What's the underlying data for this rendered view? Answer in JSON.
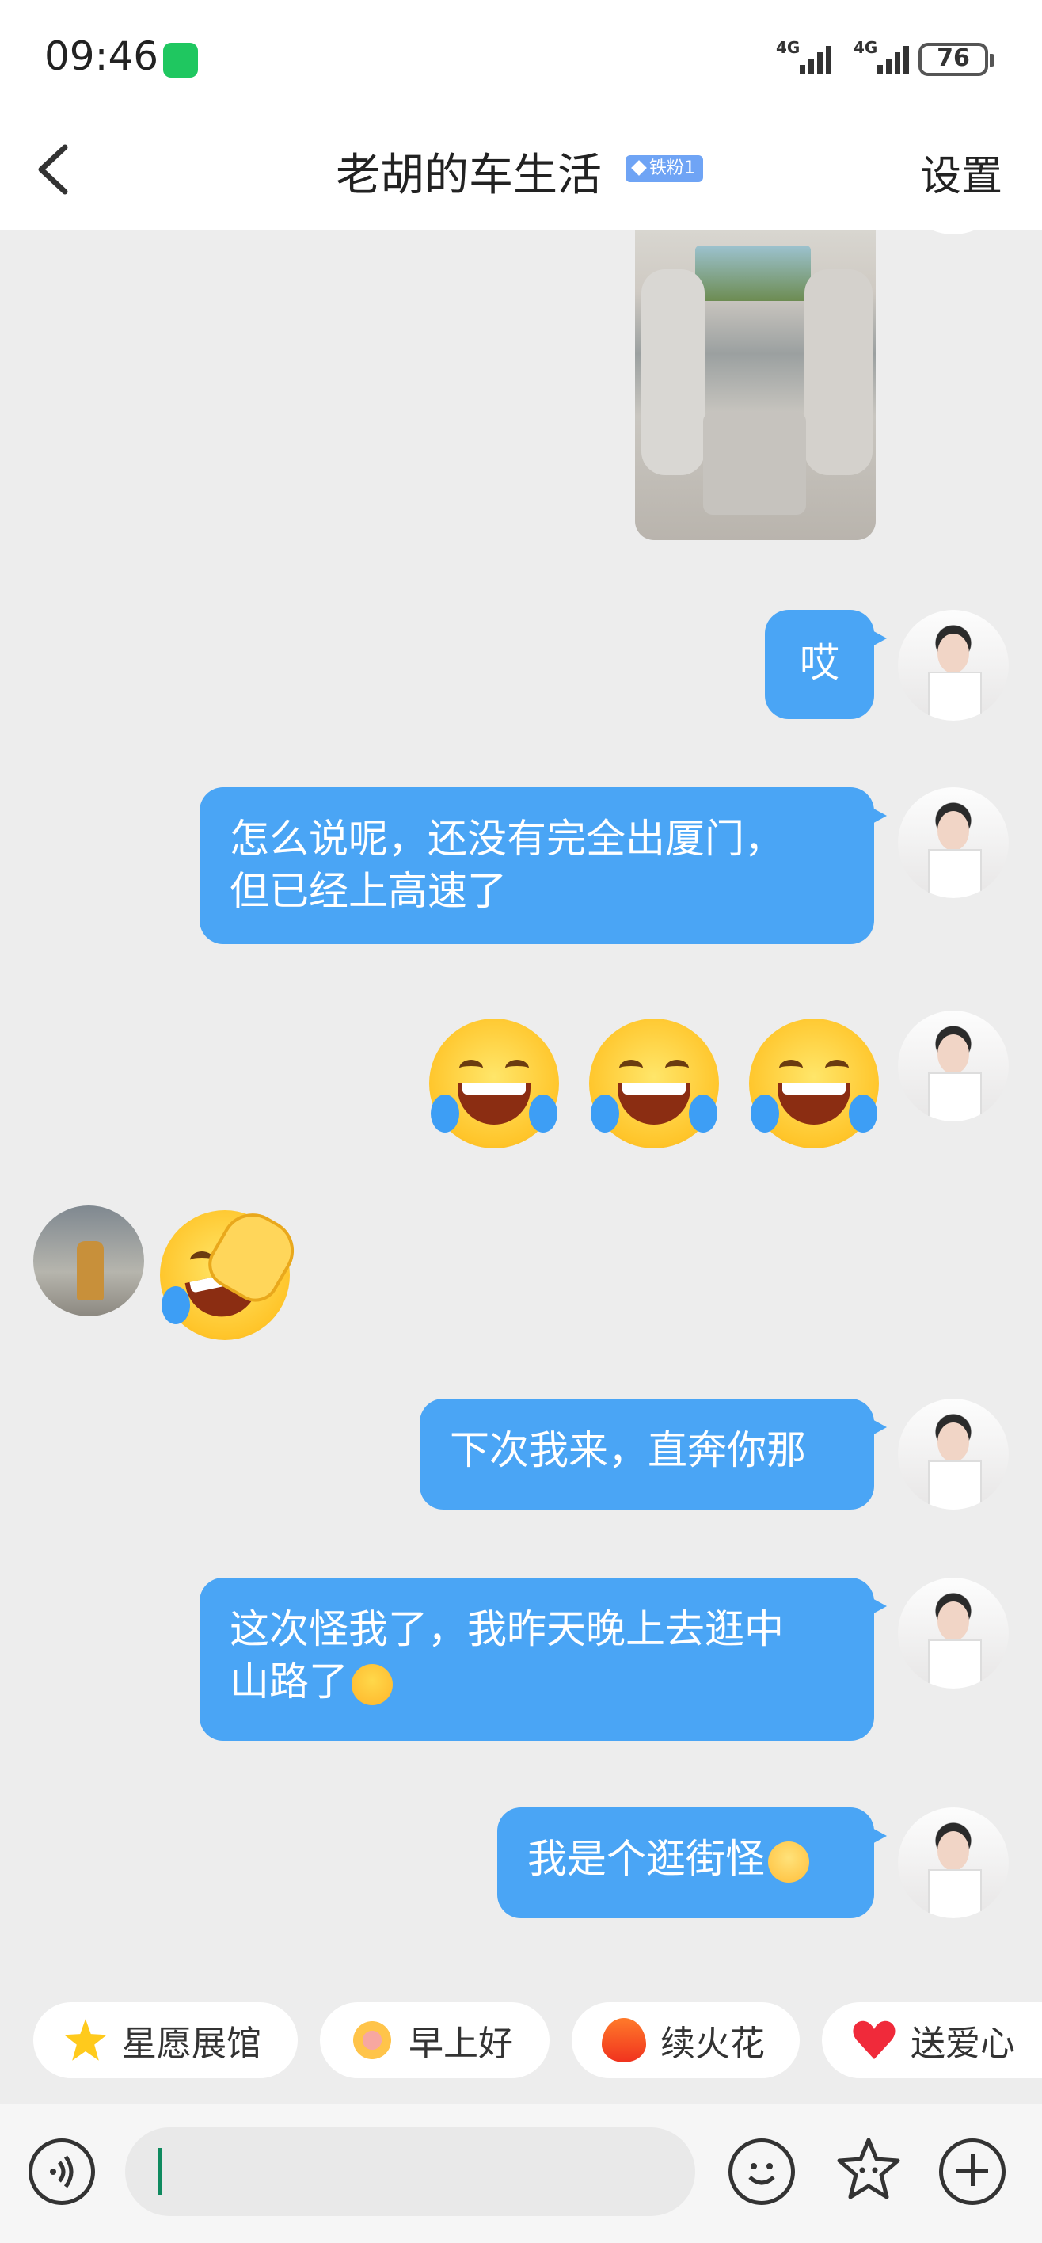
{
  "status_bar": {
    "time": "09:46",
    "network_1": "4G",
    "network_2": "4G",
    "battery": "76",
    "app_icon": "wechat-icon"
  },
  "header": {
    "title": "老胡的车生活",
    "badge": "铁粉1",
    "settings_label": "设置",
    "back_icon": "chevron-left-icon"
  },
  "messages": [
    {
      "sender": "me",
      "type": "image"
    },
    {
      "sender": "me",
      "type": "text",
      "lines": [
        "哎"
      ]
    },
    {
      "sender": "me",
      "type": "text",
      "lines": [
        "怎么说呢，还没有完全出厦门，",
        "但已经上高速了"
      ]
    },
    {
      "sender": "me",
      "type": "emoji",
      "emoji": [
        "laughing-crying-emoji",
        "laughing-crying-emoji",
        "laughing-crying-emoji"
      ]
    },
    {
      "sender": "other",
      "type": "emoji",
      "emoji": [
        "facepalm-laughing-emoji"
      ]
    },
    {
      "sender": "me",
      "type": "text",
      "lines": [
        "下次我来，直奔你那"
      ]
    },
    {
      "sender": "me",
      "type": "text",
      "lines": [
        "这次怪我了，我昨天晚上去逛中",
        "山路了"
      ],
      "trailing_emoji": "crying-emoji"
    },
    {
      "sender": "me",
      "type": "text",
      "lines": [
        "我是个逛街怪"
      ],
      "trailing_emoji": "teary-smile-emoji"
    }
  ],
  "quick_actions": [
    {
      "label": "星愿展馆",
      "icon": "star-icon"
    },
    {
      "label": "早上好",
      "icon": "sun-icon"
    },
    {
      "label": "续火花",
      "icon": "fire-icon"
    },
    {
      "label": "送爱心",
      "icon": "heart-icon"
    }
  ],
  "input_bar": {
    "voice_icon": "voice-icon",
    "emoji_icon": "emoji-icon",
    "sticker_icon": "sticker-icon",
    "plus_icon": "plus-icon",
    "input_value": ""
  },
  "colors": {
    "bubble": "#4aa5f5",
    "background": "#ededed",
    "badge": "#6fa4f5"
  }
}
